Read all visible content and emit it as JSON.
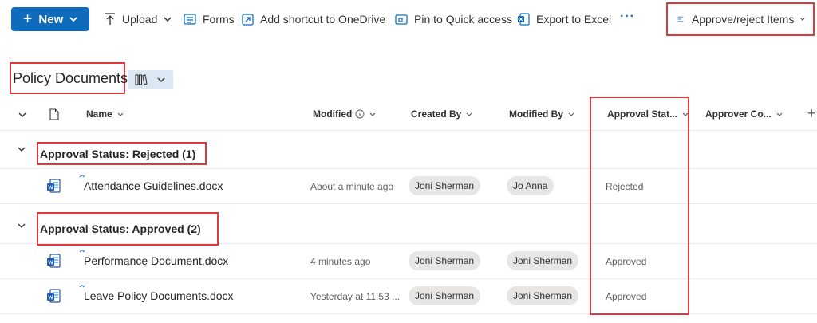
{
  "toolbar": {
    "new_label": "New",
    "upload_label": "Upload",
    "forms_label": "Forms",
    "shortcut_label": "Add shortcut to OneDrive",
    "pin_label": "Pin to Quick access",
    "export_label": "Export to Excel",
    "more_label": "···",
    "approve_label": "Approve/reject Items",
    "accent_color": "#0f6cbd"
  },
  "library": {
    "title": "Policy Documents"
  },
  "columns": {
    "name": "Name",
    "modified": "Modified",
    "created_by": "Created By",
    "modified_by": "Modified By",
    "approval_status": "Approval Stat...",
    "approver_comments": "Approver Co...",
    "add_column": "+"
  },
  "groups": [
    {
      "label": "Approval Status: Rejected (1)",
      "rows": [
        {
          "name": "Attendance Guidelines.docx",
          "modified": "About a minute ago",
          "created_by": "Joni Sherman",
          "modified_by": "Jo Anna",
          "status": "Rejected"
        }
      ]
    },
    {
      "label": "Approval Status: Approved (2)",
      "rows": [
        {
          "name": "Performance Document.docx",
          "modified": "4 minutes ago",
          "created_by": "Joni Sherman",
          "modified_by": "Joni Sherman",
          "status": "Approved"
        },
        {
          "name": "Leave Policy Documents.docx",
          "modified": "Yesterday at 11:53 ...",
          "created_by": "Joni Sherman",
          "modified_by": "Joni Sherman",
          "status": "Approved"
        }
      ]
    }
  ],
  "highlight_color": "#e0383e",
  "icons": [
    "plus-icon",
    "upload-icon",
    "forms-icon",
    "shortcut-icon",
    "pin-icon",
    "excel-icon",
    "approve-icon",
    "library-view-icon",
    "file-icon",
    "info-icon",
    "word-doc-icon",
    "new-file-spark-icon"
  ]
}
